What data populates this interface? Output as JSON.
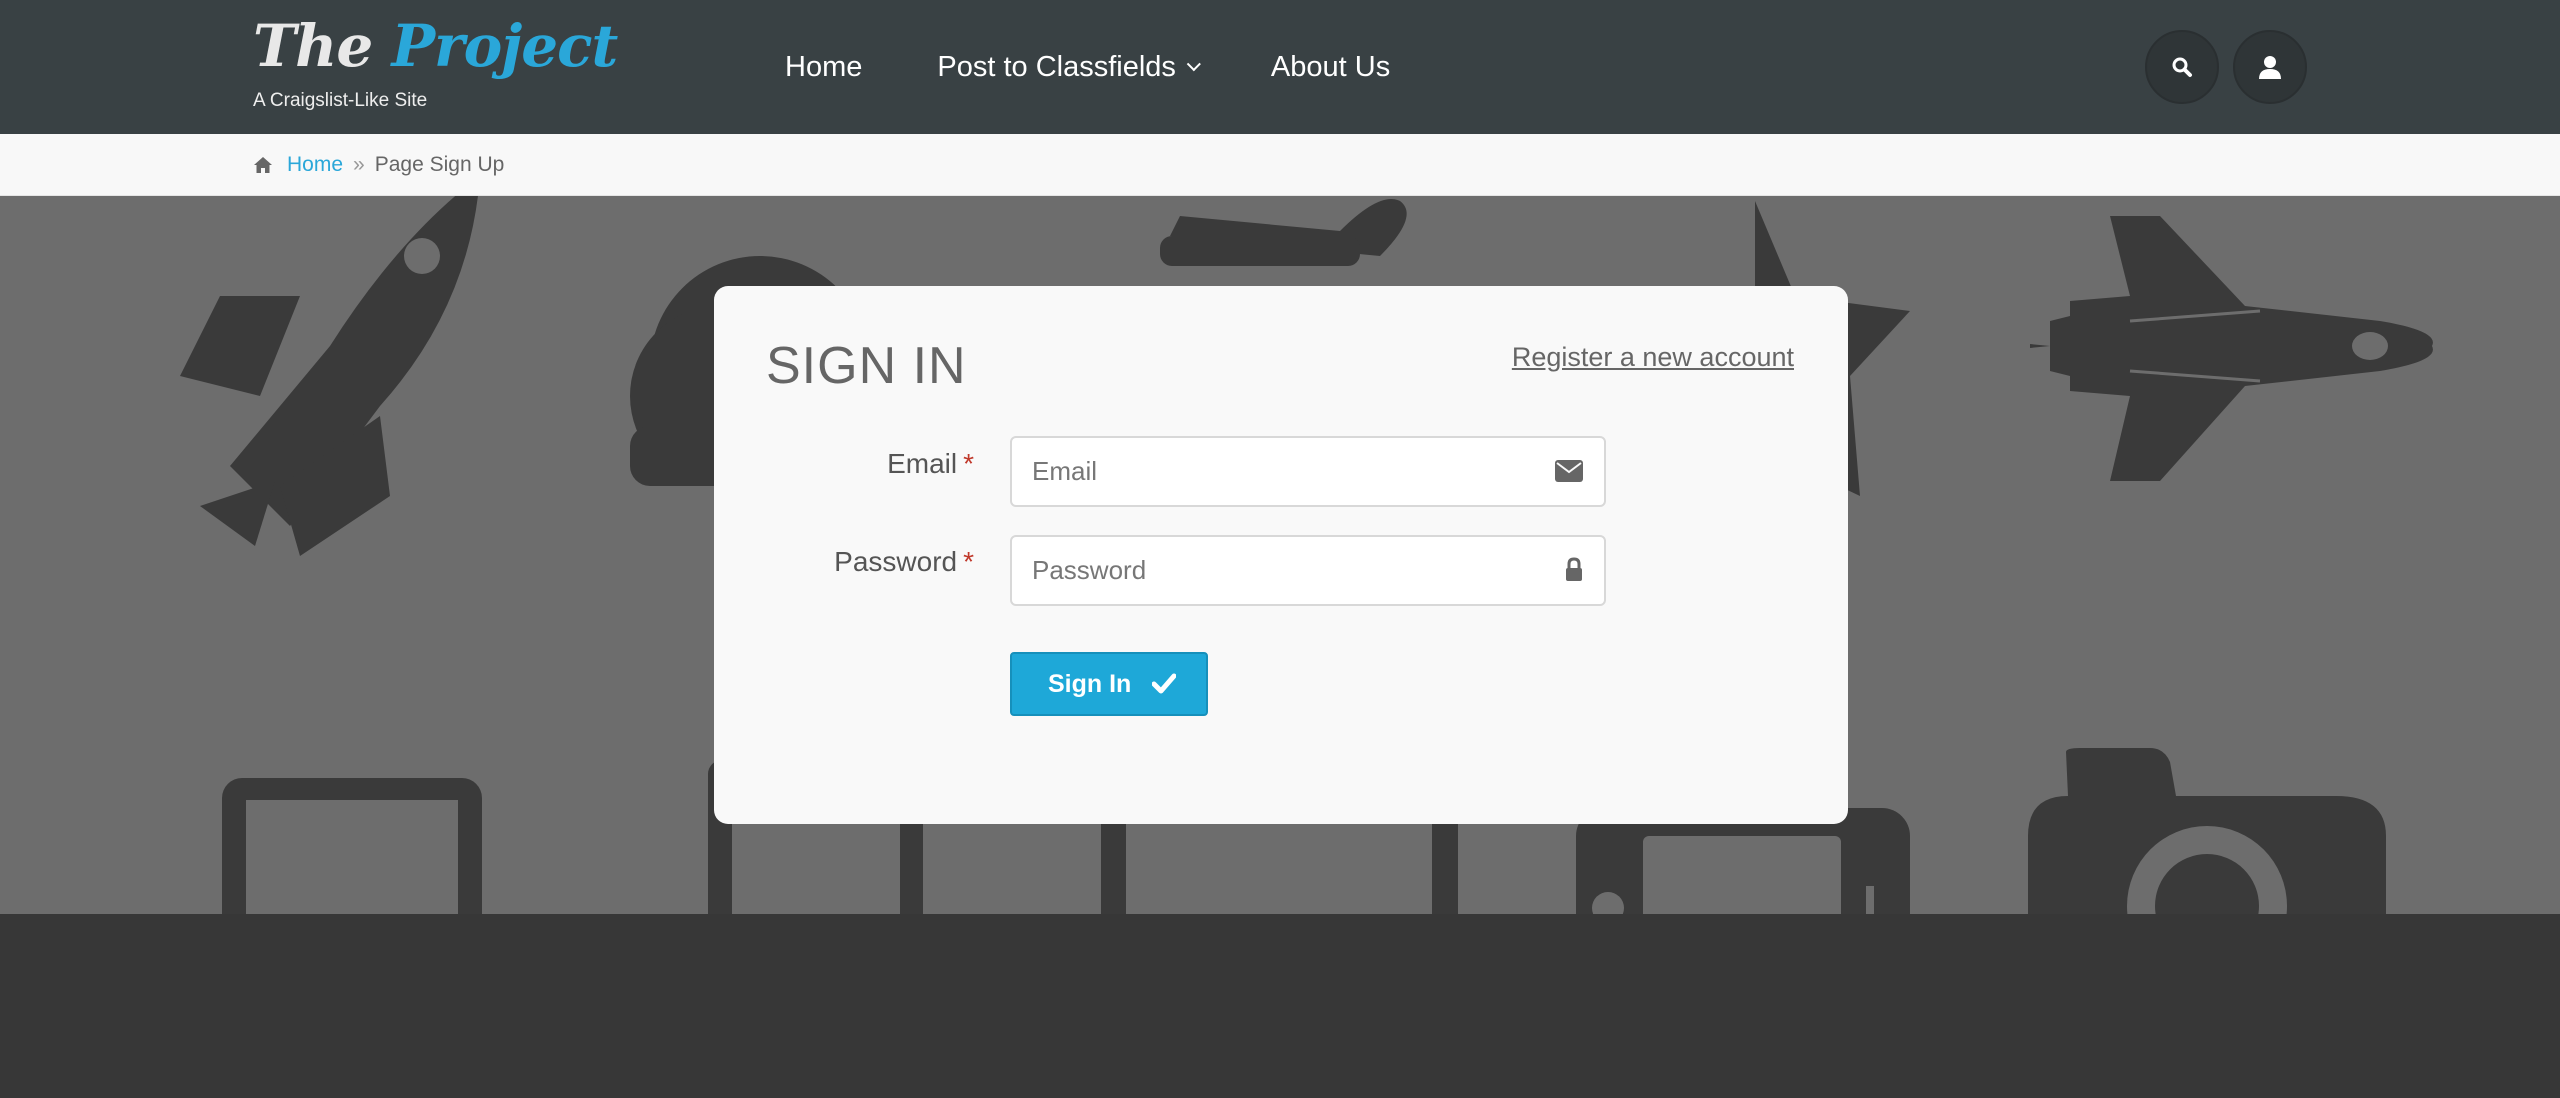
{
  "header": {
    "logo_the": "The",
    "logo_project": "Project",
    "tagline": "A Craigslist-Like Site",
    "nav": [
      {
        "label": "Home"
      },
      {
        "label": "Post to Classfields"
      },
      {
        "label": "About Us"
      }
    ],
    "search_icon": "search-icon",
    "user_icon": "user-icon"
  },
  "breadcrumb": {
    "home_icon": "home-icon",
    "home": "Home",
    "separator": "»",
    "current": "Page Sign Up"
  },
  "signin": {
    "title": "SIGN IN",
    "register_link": "Register a new account",
    "email_label": "Email",
    "email_placeholder": "Email",
    "email_value": "",
    "password_label": "Password",
    "password_placeholder": "Password",
    "password_value": "",
    "required_mark": "*",
    "submit_label": "Sign In"
  },
  "colors": {
    "header_bg": "#394144",
    "accent": "#2aa7d9",
    "hero_bg": "#6d6d6d",
    "footer_bg": "#373737",
    "button": "#1ea8d8",
    "required": "#c0392b"
  }
}
